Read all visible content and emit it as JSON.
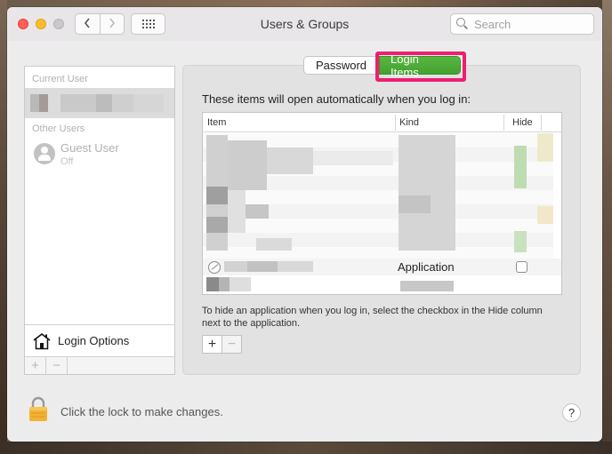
{
  "window": {
    "title": "Users & Groups",
    "search_placeholder": "Search"
  },
  "sidebar": {
    "current_user_label": "Current User",
    "other_users_label": "Other Users",
    "guest": {
      "name": "Guest User",
      "status": "Off"
    },
    "login_options_label": "Login Options",
    "add_label": "+",
    "remove_label": "−"
  },
  "tabs": {
    "password": "Password",
    "login_items": "Login Items",
    "selected": "login_items"
  },
  "main": {
    "intro": "These items will open automatically when you log in:",
    "columns": {
      "item": "Item",
      "kind": "Kind",
      "hide": "Hide"
    },
    "visible_row": {
      "kind": "Application",
      "hide_checked": false
    },
    "help_text": "To hide an application when you log in, select the checkbox in the Hide column next to the application.",
    "add_label": "+",
    "remove_label": "−"
  },
  "footer": {
    "lock_text": "Click the lock to make changes.",
    "help_label": "?"
  },
  "colors": {
    "highlight": "#ee1f6e",
    "selected_tab": "#4aac36"
  }
}
